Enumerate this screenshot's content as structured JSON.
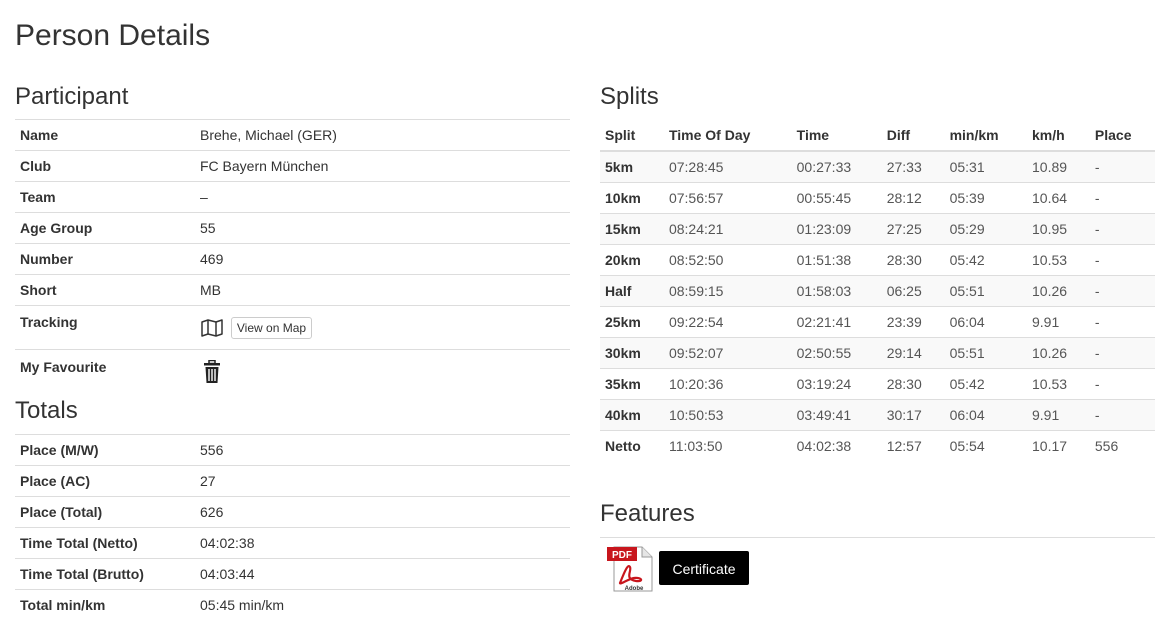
{
  "page_title": "Person Details",
  "participant": {
    "heading": "Participant",
    "rows": [
      {
        "label": "Name",
        "value": "Brehe, Michael (GER)"
      },
      {
        "label": "Club",
        "value": "FC Bayern München"
      },
      {
        "label": "Team",
        "value": "–"
      },
      {
        "label": "Age Group",
        "value": "55"
      },
      {
        "label": "Number",
        "value": "469"
      },
      {
        "label": "Short",
        "value": "MB"
      }
    ],
    "tracking_label": "Tracking",
    "view_on_map": "View on Map",
    "favourite_label": "My Favourite"
  },
  "totals": {
    "heading": "Totals",
    "rows": [
      {
        "label": "Place (M/W)",
        "value": "556"
      },
      {
        "label": "Place (AC)",
        "value": "27"
      },
      {
        "label": "Place (Total)",
        "value": "626"
      },
      {
        "label": "Time Total (Netto)",
        "value": "04:02:38"
      },
      {
        "label": "Time Total (Brutto)",
        "value": "04:03:44"
      },
      {
        "label": "Total min/km",
        "value": "05:45 min/km"
      }
    ]
  },
  "splits": {
    "heading": "Splits",
    "columns": [
      "Split",
      "Time Of Day",
      "Time",
      "Diff",
      "min/km",
      "km/h",
      "Place"
    ],
    "rows": [
      [
        "5km",
        "07:28:45",
        "00:27:33",
        "27:33",
        "05:31",
        "10.89",
        "-"
      ],
      [
        "10km",
        "07:56:57",
        "00:55:45",
        "28:12",
        "05:39",
        "10.64",
        "-"
      ],
      [
        "15km",
        "08:24:21",
        "01:23:09",
        "27:25",
        "05:29",
        "10.95",
        "-"
      ],
      [
        "20km",
        "08:52:50",
        "01:51:38",
        "28:30",
        "05:42",
        "10.53",
        "-"
      ],
      [
        "Half",
        "08:59:15",
        "01:58:03",
        "06:25",
        "05:51",
        "10.26",
        "-"
      ],
      [
        "25km",
        "09:22:54",
        "02:21:41",
        "23:39",
        "06:04",
        "9.91",
        "-"
      ],
      [
        "30km",
        "09:52:07",
        "02:50:55",
        "29:14",
        "05:51",
        "10.26",
        "-"
      ],
      [
        "35km",
        "10:20:36",
        "03:19:24",
        "28:30",
        "05:42",
        "10.53",
        "-"
      ],
      [
        "40km",
        "10:50:53",
        "03:49:41",
        "30:17",
        "06:04",
        "9.91",
        "-"
      ],
      [
        "Netto",
        "11:03:50",
        "04:02:38",
        "12:57",
        "05:54",
        "10.17",
        "556"
      ]
    ]
  },
  "features": {
    "heading": "Features",
    "certificate_button": "Certificate",
    "pdf_icon_label": "PDF",
    "pdf_icon_sublabel": "Adobe"
  }
}
